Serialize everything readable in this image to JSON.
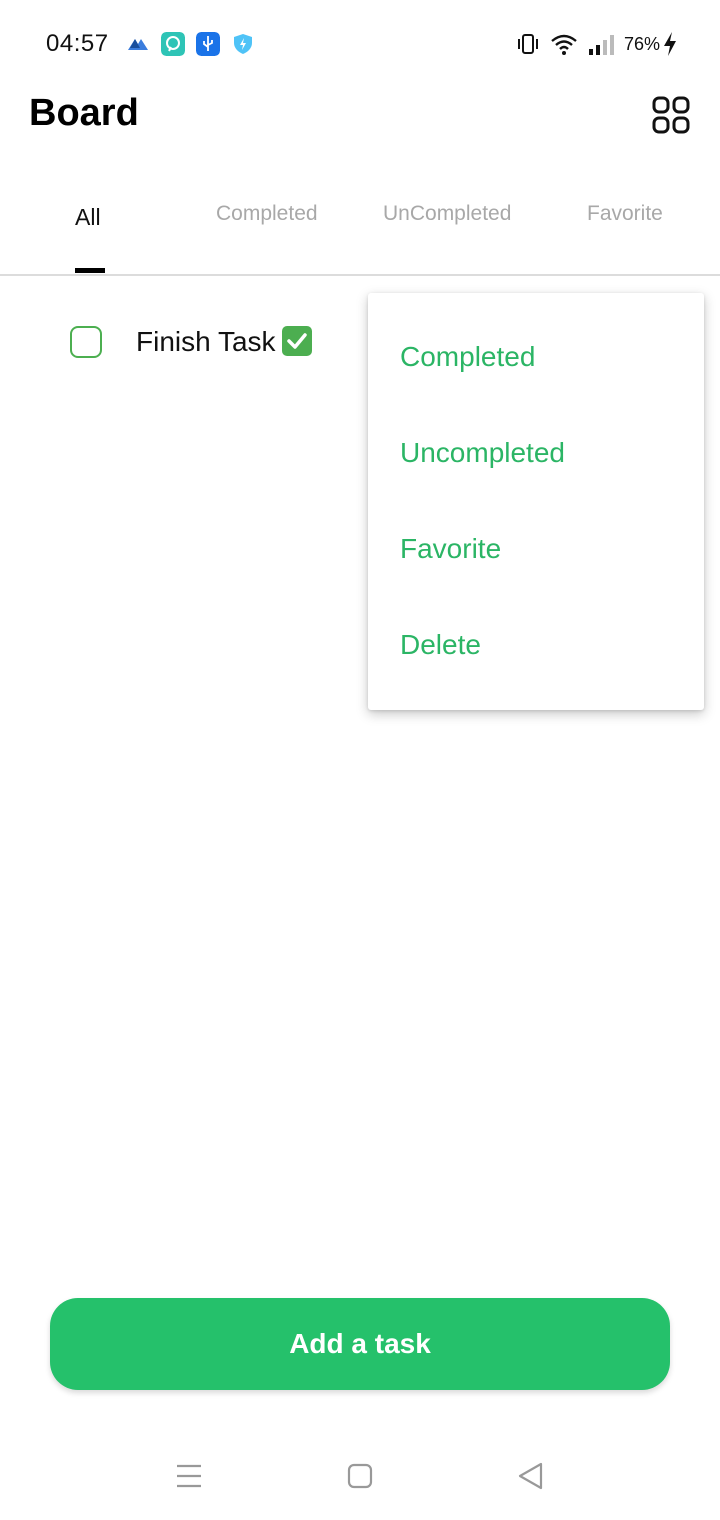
{
  "status_bar": {
    "time": "04:57",
    "battery_percent": "76%",
    "icons": [
      "app-icon-1",
      "app-icon-2",
      "usb-icon",
      "shield-icon",
      "vibrate-icon",
      "wifi-icon",
      "signal-icon",
      "charging-icon"
    ]
  },
  "header": {
    "title": "Board",
    "action_icon": "grid-icon"
  },
  "tabs": [
    {
      "label": "All",
      "active": true
    },
    {
      "label": "Completed",
      "active": false
    },
    {
      "label": "UnCompleted",
      "active": false
    },
    {
      "label": "Favorite",
      "active": false
    }
  ],
  "tasks": [
    {
      "text": "Finish Task",
      "completed": false
    }
  ],
  "context_menu": {
    "items": [
      "Completed",
      "Uncompleted",
      "Favorite",
      "Delete"
    ]
  },
  "add_button": {
    "label": "Add a task"
  },
  "nav_bar": {
    "icons": [
      "menu-icon",
      "home-icon",
      "back-icon"
    ]
  },
  "colors": {
    "accent": "#25c16b",
    "menu_text": "#2bb565",
    "checkbox_border": "#4caf50"
  }
}
